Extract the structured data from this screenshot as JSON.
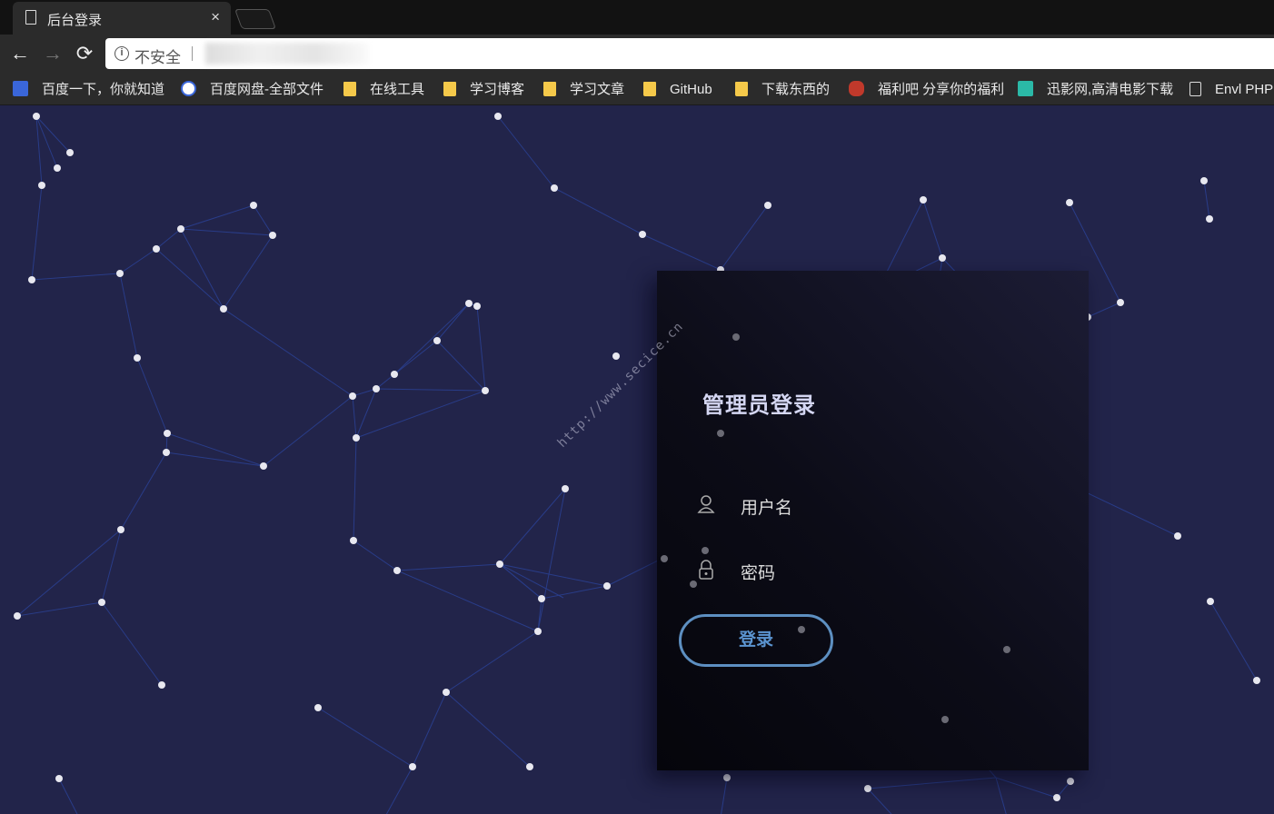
{
  "browser": {
    "tab_title": "后台登录",
    "tab_close": "×",
    "security_text": "不安全",
    "back_glyph": "←",
    "forward_glyph": "→",
    "reload_glyph": "⟳",
    "info_glyph": "i"
  },
  "bookmarks": [
    {
      "label": "百度一下，你就知道",
      "icon": "baidu-icon"
    },
    {
      "label": "百度网盘-全部文件",
      "icon": "baidu-pan-icon"
    },
    {
      "label": "在线工具",
      "icon": "folder-icon"
    },
    {
      "label": "学习博客",
      "icon": "folder-icon"
    },
    {
      "label": "学习文章",
      "icon": "folder-icon"
    },
    {
      "label": "GitHub",
      "icon": "folder-icon"
    },
    {
      "label": "下载东西的",
      "icon": "folder-icon"
    },
    {
      "label": "福利吧 分享你的福利",
      "icon": "fuli-icon"
    },
    {
      "label": "迅影网,高清电影下载",
      "icon": "xunying-icon"
    },
    {
      "label": "Envl PHP",
      "icon": "page-icon"
    }
  ],
  "login": {
    "title": "管理员登录",
    "username_label": "用户名",
    "password_label": "密码",
    "submit_label": "登录",
    "username_icon": "user-icon",
    "password_icon": "lock-icon"
  },
  "watermark": "http://www.secice.cn",
  "colors": {
    "background": "#22244a",
    "link_line": "#2a3f8f",
    "node": "#e8e8f0",
    "button_border": "#5d8fc1",
    "button_text": "#5b94d0"
  }
}
